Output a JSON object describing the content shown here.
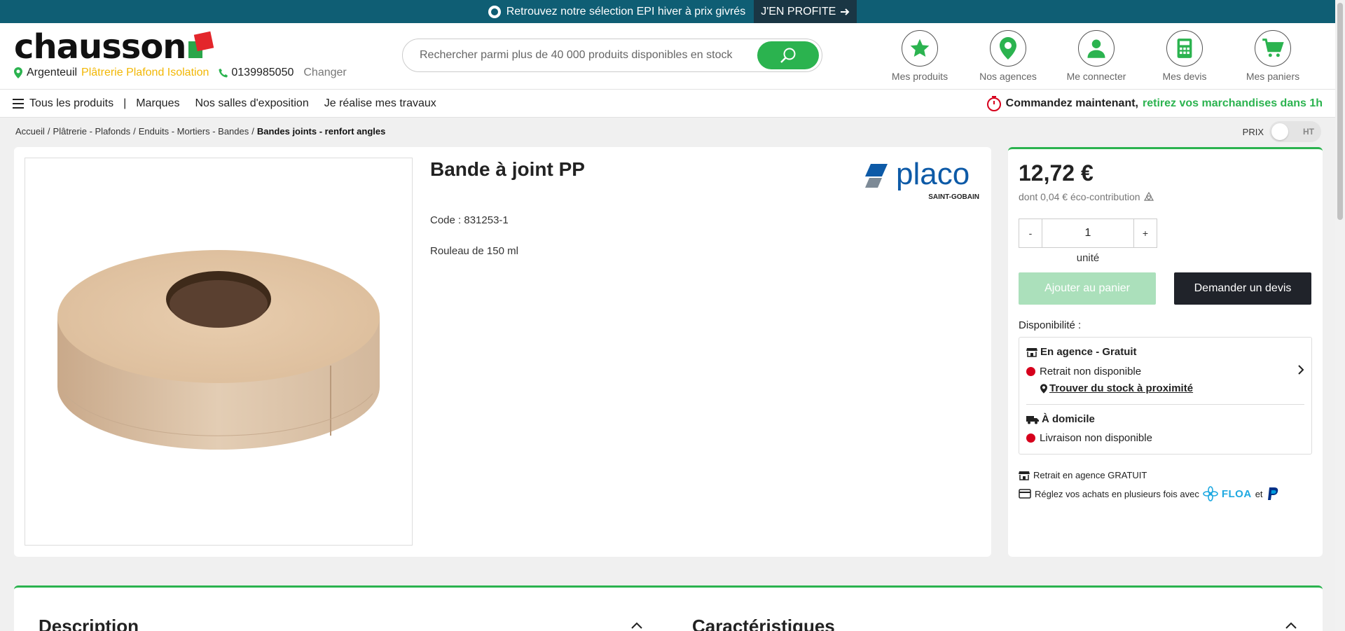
{
  "promo": {
    "text": "Retrouvez notre sélection EPI hiver à prix givrés",
    "cta": "J'EN PROFITE"
  },
  "header": {
    "logo": "chausson",
    "store_city": "Argenteuil",
    "store_specialty": "Plâtrerie Plafond Isolation",
    "store_phone": "0139985050",
    "store_change": "Changer",
    "search_placeholder": "Rechercher parmi plus de 40 000 produits disponibles en stock",
    "nav": [
      {
        "label": "Mes produits",
        "icon": "star-icon"
      },
      {
        "label": "Nos agences",
        "icon": "location-pin-icon"
      },
      {
        "label": "Me connecter",
        "icon": "user-icon"
      },
      {
        "label": "Mes devis",
        "icon": "calculator-icon"
      },
      {
        "label": "Mes paniers",
        "icon": "cart-icon"
      }
    ]
  },
  "menu": {
    "all_products": "Tous les produits",
    "separator": "|",
    "items": [
      "Marques",
      "Nos salles d'exposition",
      "Je réalise mes travaux"
    ],
    "order_bold": "Commandez maintenant,",
    "order_green": "retirez vos marchandises dans 1h"
  },
  "breadcrumb": {
    "items": [
      "Accueil",
      "Plâtrerie - Plafonds",
      "Enduits - Mortiers - Bandes"
    ],
    "current": "Bandes joints - renfort angles",
    "separator": "/"
  },
  "price_toggle": {
    "label": "PRIX",
    "value": "HT"
  },
  "product": {
    "title": "Bande à joint PP",
    "code": "Code : 831253-1",
    "description": "Rouleau de 150 ml",
    "brand_name": "placo",
    "brand_sub": "SAINT-GOBAIN"
  },
  "buy": {
    "price": "12,72 €",
    "eco": "dont 0,04 € éco-contribution",
    "qty_minus": "-",
    "qty_value": "1",
    "qty_plus": "+",
    "unit": "unité",
    "add_to_cart": "Ajouter au panier",
    "request_quote": "Demander un devis",
    "availability_label": "Disponibilité :",
    "store_title": "En agence - Gratuit",
    "store_status": "Retrait non disponible",
    "find_stock": "Trouver du stock à proximité",
    "home_title": "À domicile",
    "home_status": "Livraison non disponible",
    "info_pickup": "Retrait en agence GRATUIT",
    "info_installments": "Réglez vos achats en plusieurs fois avec",
    "floa": "FLOA",
    "and": "et"
  },
  "lower": {
    "description": "Description",
    "characteristics": "Caractéristiques"
  },
  "colors": {
    "promo_bg": "#0f5e74",
    "green": "#2bb34f",
    "status_red": "#d6001c",
    "dark_button": "#20232a"
  }
}
